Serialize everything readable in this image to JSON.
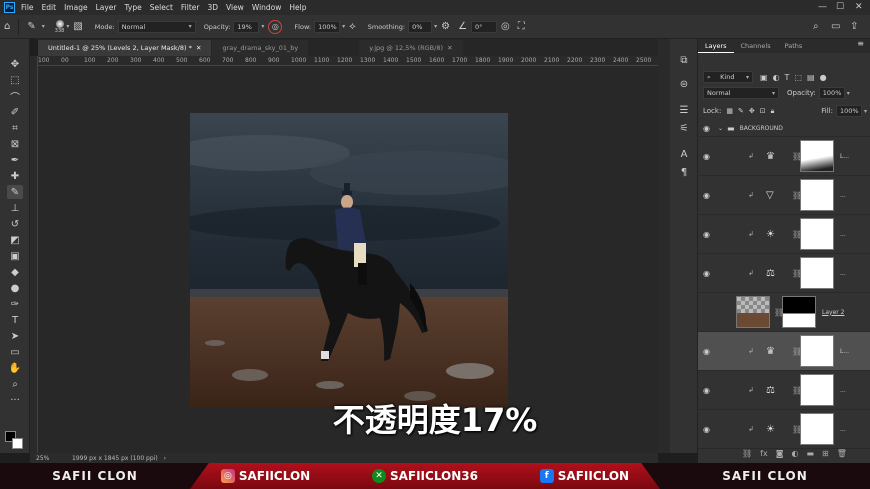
{
  "app": {
    "logo": "Ps"
  },
  "menu": [
    "File",
    "Edit",
    "Image",
    "Layer",
    "Type",
    "Select",
    "Filter",
    "3D",
    "View",
    "Window",
    "Help"
  ],
  "options": {
    "brush_size": "338",
    "mode_label": "Mode:",
    "mode_value": "Normal",
    "opacity_label": "Opacity:",
    "opacity_value": "19%",
    "flow_label": "Flow:",
    "flow_value": "100%",
    "smoothing_label": "Smoothing:",
    "smoothing_value": "0%",
    "angle_value": "0°"
  },
  "tabs": [
    {
      "label": "Untitled-1 @ 25% (Levels 2, Layer Mask/8) *"
    },
    {
      "label": "gray_drama_sky_01_by"
    },
    {
      "label": "y.jpg @ 12,5% (RGB/8)"
    }
  ],
  "ruler": [
    "100",
    "00",
    "100",
    "200",
    "300",
    "400",
    "500",
    "600",
    "700",
    "800",
    "900",
    "1000",
    "1100",
    "1200",
    "1300",
    "1400",
    "1500",
    "1600",
    "1700",
    "1800",
    "1900",
    "2000",
    "2100",
    "2200",
    "2300",
    "2400",
    "2500",
    "2600"
  ],
  "status": {
    "zoom": "25%",
    "doc_info": "1999 px x 1845 px (100 ppi)"
  },
  "subtitle": "不透明度17%",
  "panel": {
    "tabs": [
      "Layers",
      "Channels",
      "Paths"
    ],
    "kind": "Kind",
    "blend": "Normal",
    "opacity_label": "Opacity:",
    "opacity_value": "100%",
    "lock_label": "Lock:",
    "fill_label": "Fill:",
    "fill_value": "100%",
    "group_name": "BACKGROUND",
    "layers": [
      {
        "icon": "levels-icon",
        "glyph": "♛",
        "name": "L..."
      },
      {
        "icon": "triangle-icon",
        "glyph": "▽",
        "name": "..."
      },
      {
        "icon": "brightness-icon",
        "glyph": "☀",
        "name": "..."
      },
      {
        "icon": "balance-icon",
        "glyph": "⚖",
        "name": "..."
      },
      {
        "icon": "image-icon",
        "glyph": "",
        "name": "Layer 2"
      },
      {
        "icon": "levels-icon",
        "glyph": "♛",
        "name": "L..."
      },
      {
        "icon": "balance-icon",
        "glyph": "⚖",
        "name": "..."
      },
      {
        "icon": "brightness-icon",
        "glyph": "☀",
        "name": "..."
      }
    ]
  },
  "footer": {
    "left": "SAFII CLON",
    "instagram": "SAFIICLON",
    "xbox": "SAFIICLON36",
    "facebook": "SAFIICLON",
    "right": "SAFII CLON"
  }
}
